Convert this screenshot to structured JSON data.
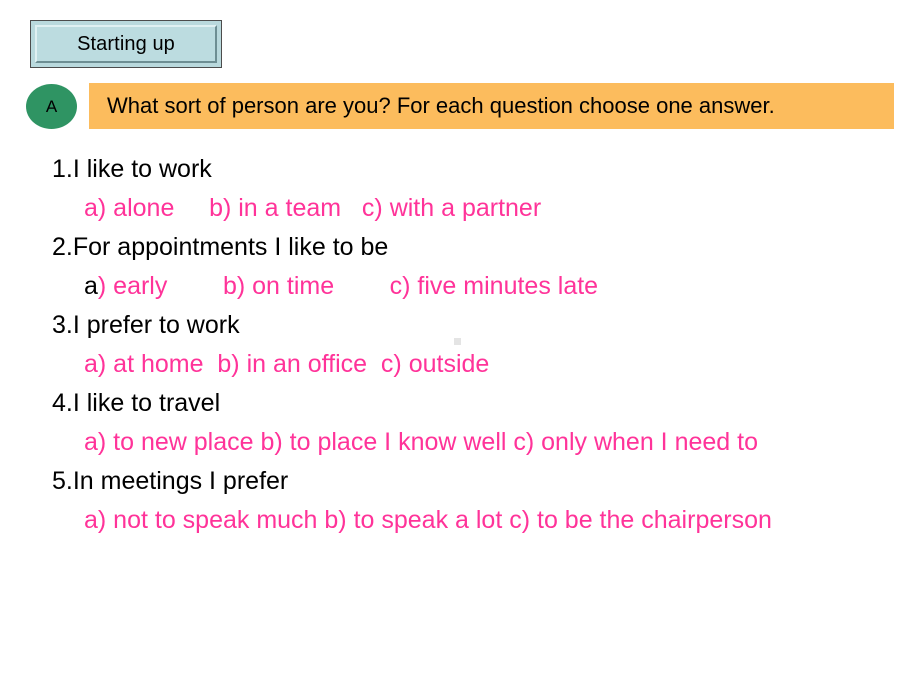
{
  "section": {
    "title": "Starting up"
  },
  "task": {
    "badge": "A",
    "instruction": "What sort of person are you? For each question choose one answer."
  },
  "questions": [
    {
      "number": "1.",
      "stem": "I like to work",
      "options_text": "a) alone     b) in a team   c) with a partner",
      "options": [
        {
          "letter": "a)",
          "text": "alone"
        },
        {
          "letter": "b)",
          "text": "in a team"
        },
        {
          "letter": "c)",
          "text": "with a partner"
        }
      ]
    },
    {
      "number": "2.",
      "stem": "For appointments I like to be",
      "option_a_letter": "a",
      "option_a_rest": ") early",
      "options_tail": "        b) on time        c) five minutes late",
      "options": [
        {
          "letter": "a)",
          "text": "early"
        },
        {
          "letter": "b)",
          "text": "on time"
        },
        {
          "letter": "c)",
          "text": "five minutes late"
        }
      ]
    },
    {
      "number": "3.",
      "stem": "I prefer to work",
      "options_text": "a) at home  b) in an office  c) outside",
      "options": [
        {
          "letter": "a)",
          "text": "at home"
        },
        {
          "letter": "b)",
          "text": "in an office"
        },
        {
          "letter": "c)",
          "text": "outside"
        }
      ]
    },
    {
      "number": "4.",
      "stem": "I like to travel",
      "options_text": "a) to new place  b) to place I know well  c) only when I need to",
      "options": [
        {
          "letter": "a)",
          "text": "to new place"
        },
        {
          "letter": "b)",
          "text": "to place I know well"
        },
        {
          "letter": "c)",
          "text": "only when I need to"
        }
      ]
    },
    {
      "number": "5.",
      "stem": "In meetings I prefer",
      "options_text": "a) not to speak much   b) to speak a lot   c) to be the chairperson",
      "options": [
        {
          "letter": "a)",
          "text": "not to speak much"
        },
        {
          "letter": "b)",
          "text": "to speak a lot"
        },
        {
          "letter": "c)",
          "text": "to be the chairperson"
        }
      ]
    }
  ],
  "colors": {
    "option_pink": "#ff3399",
    "banner_orange": "#fcbc5d",
    "badge_green": "#2f9463",
    "title_box_blue": "#bcdce0",
    "text_black": "#000000"
  }
}
